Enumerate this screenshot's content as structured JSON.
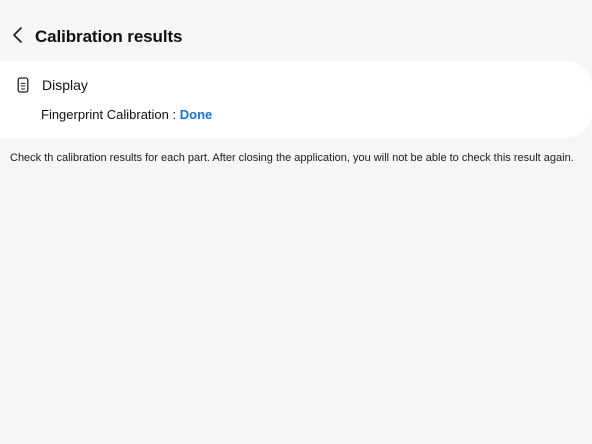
{
  "header": {
    "back_icon": "back-chevron-icon",
    "title": "Calibration results"
  },
  "card": {
    "icon": "phone-device-icon",
    "section_title": "Display",
    "result_label": "Fingerprint Calibration : ",
    "result_value": "Done",
    "result_color": "#1a73c8"
  },
  "info_text": "Check th calibration results for each part. After closing the application, you will not be able to check this result again.",
  "colors": {
    "background": "#f6f6f6",
    "card": "#ffffff",
    "accent": "#1a73c8"
  }
}
